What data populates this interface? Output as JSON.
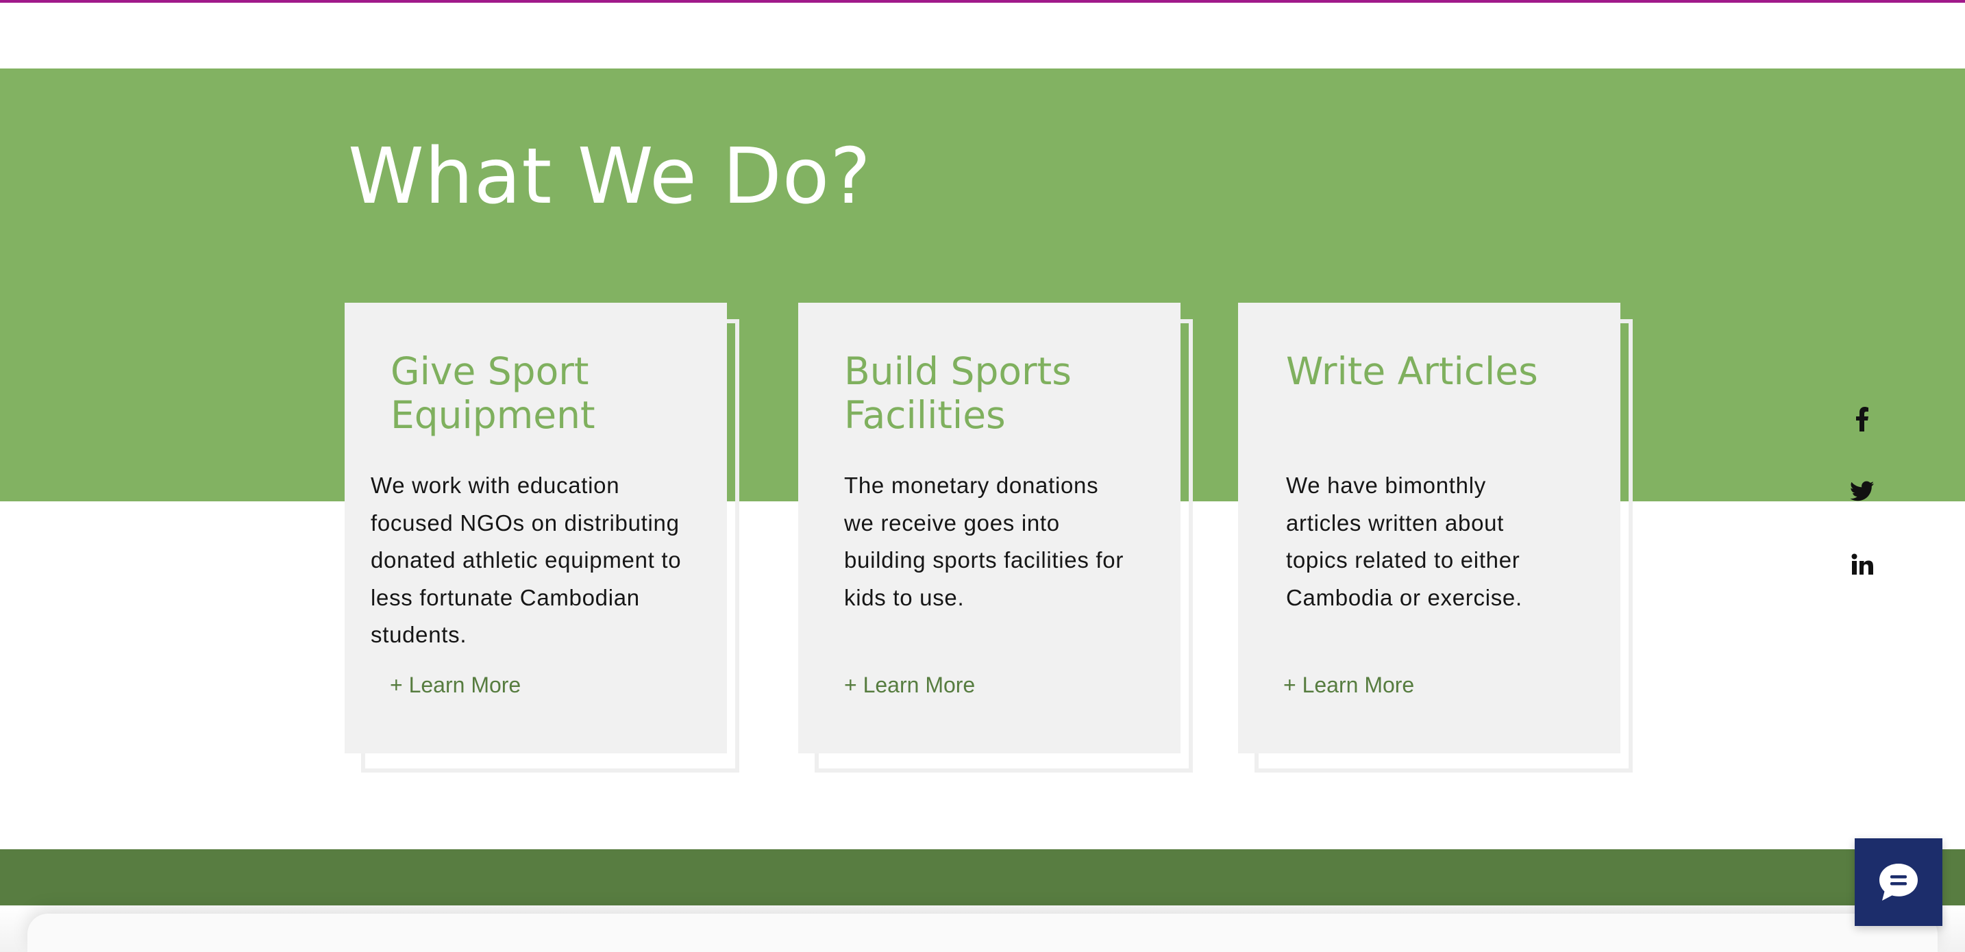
{
  "section": {
    "title": "What We Do?"
  },
  "cards": [
    {
      "title": "Give Sport\nEquipment",
      "body": "We work with education focused NGOs on distributing donated athletic equipment to less fortunate Cambodian students.",
      "link": "+ Learn More"
    },
    {
      "title": "Build Sports\nFacilities",
      "body": "The monetary donations we receive goes into building sports facilities for kids to use.",
      "link": "+ Learn More"
    },
    {
      "title": "Write Articles",
      "body": "We have bimonthly articles written about topics related to either Cambodia or exercise.",
      "link": "+ Learn More"
    }
  ],
  "social": [
    {
      "icon": "facebook-icon"
    },
    {
      "icon": "twitter-icon"
    },
    {
      "icon": "linkedin-icon"
    }
  ],
  "chat": {
    "icon": "chat-bubble-icon"
  },
  "colors": {
    "accent_top": "#a0198a",
    "band_green": "#82b262",
    "title_green": "#7fb05e",
    "link_green": "#567c3f",
    "footer_green": "#587d41",
    "card_bg": "#f1f1f1",
    "chat_bg": "#1c2d6b"
  }
}
